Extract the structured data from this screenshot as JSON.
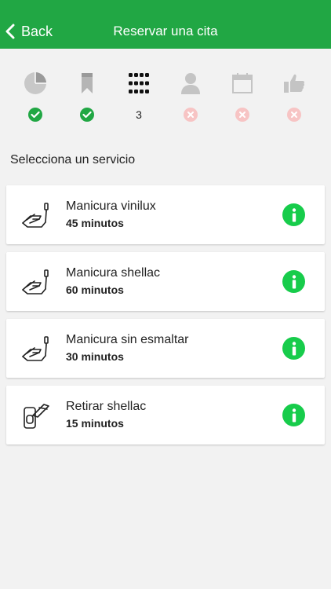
{
  "nav": {
    "back_label": "Back",
    "title": "Reservar una cita",
    "bar_color": "#21a744"
  },
  "steps": [
    {
      "icon": "pie-chart-icon",
      "status": "done"
    },
    {
      "icon": "bookmark-icon",
      "status": "done"
    },
    {
      "icon": "grid-icon",
      "status": "current",
      "label": "3"
    },
    {
      "icon": "user-icon",
      "status": "pending"
    },
    {
      "icon": "calendar-icon",
      "status": "pending"
    },
    {
      "icon": "thumbs-up-icon",
      "status": "pending"
    }
  ],
  "section_title": "Selecciona un servicio",
  "services": [
    {
      "name": "Manicura vinilux",
      "duration": "45 minutos",
      "icon": "manicure-hand-icon"
    },
    {
      "name": "Manicura shellac",
      "duration": "60 minutos",
      "icon": "manicure-hand-icon"
    },
    {
      "name": "Manicura sin esmaltar",
      "duration": "30 minutos",
      "icon": "manicure-hand-icon"
    },
    {
      "name": "Retirar shellac",
      "duration": "15 minutos",
      "icon": "nail-polish-remove-icon"
    }
  ],
  "colors": {
    "accent": "#21a744",
    "info": "#17cc4b",
    "pending": "#f7c4c4",
    "background": "#f2f2f2"
  }
}
